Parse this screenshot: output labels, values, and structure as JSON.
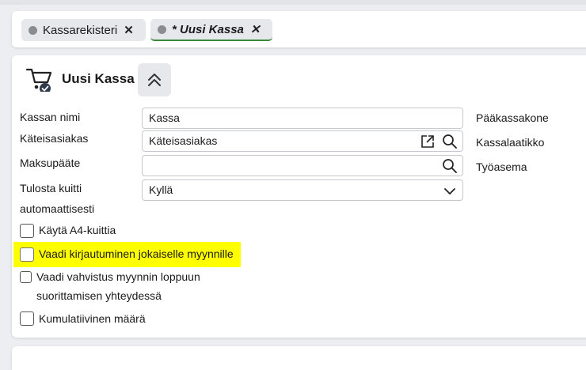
{
  "tabs": [
    {
      "label": "Kassarekisteri",
      "close": "✕"
    },
    {
      "label": "* Uusi Kassa",
      "close": "✕"
    }
  ],
  "header": {
    "title": "Uusi Kassa"
  },
  "form": {
    "kassan_nimi": {
      "label": "Kassan nimi",
      "value": "Kassa"
    },
    "kateisasiakas": {
      "label": "Käteisasiakas",
      "value": "Käteisasiakas"
    },
    "maksupaate": {
      "label": "Maksupääte",
      "value": ""
    },
    "tulosta": {
      "label_line1": "Tulosta kuitti",
      "label_line2": "automaattisesti",
      "value": "Kyllä"
    }
  },
  "checkboxes": [
    {
      "label": "Käytä A4-kuittia",
      "checked": false
    },
    {
      "label": "Vaadi kirjautuminen jokaiselle myynnille",
      "checked": false,
      "highlight": "#ffff00"
    },
    {
      "label_line1": "Vaadi vahvistus myynnin loppuun",
      "label_line2": "suorittamisen yhteydessä",
      "checked": false
    },
    {
      "label": "Kumulatiivinen määrä",
      "checked": false
    }
  ],
  "right_labels": [
    "Pääkassakone",
    "Kassalaatikko",
    "Työasema"
  ],
  "colors": {
    "active_tab_underline": "#3a8a3a",
    "highlight": "#ffff00"
  }
}
